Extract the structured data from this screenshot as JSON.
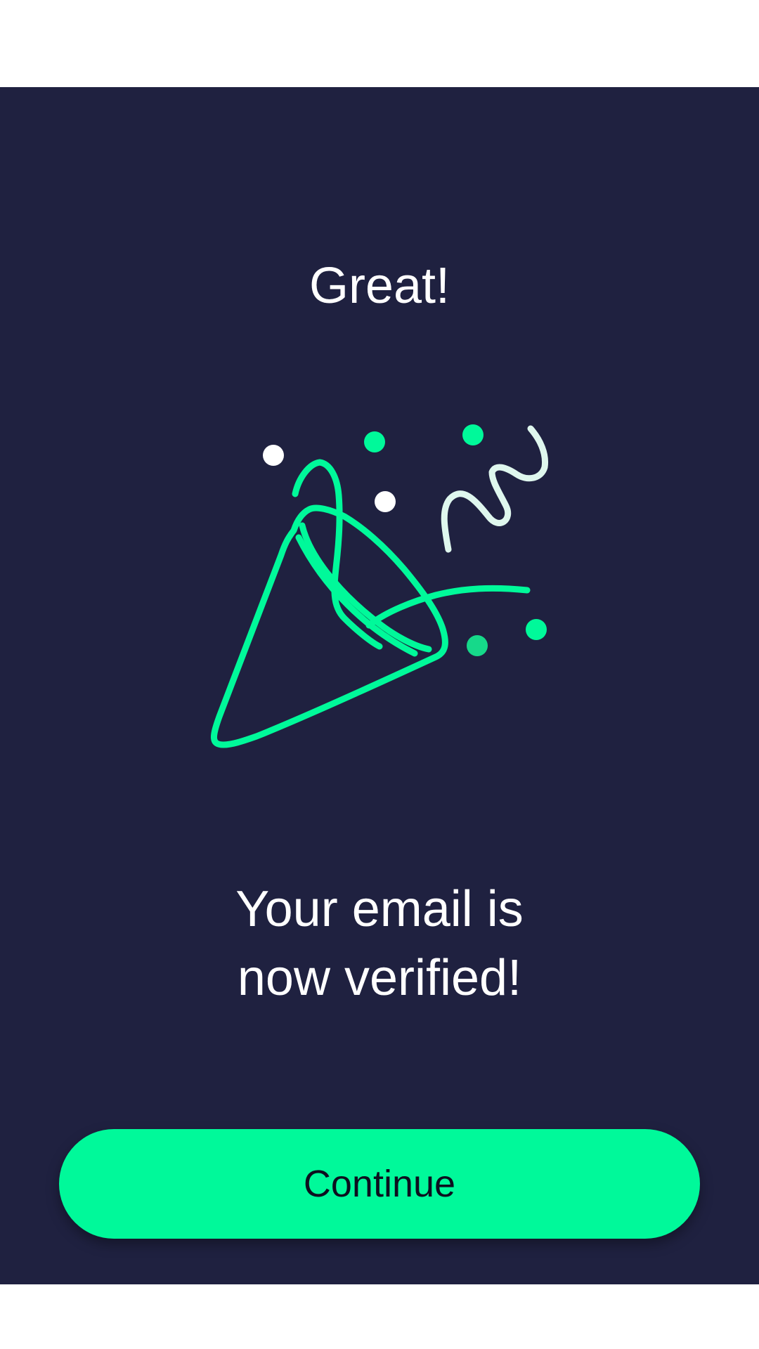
{
  "colors": {
    "background": "#1f2140",
    "accent": "#00f99a",
    "text": "#ffffff",
    "button_text": "#0d0f1f"
  },
  "heading": "Great!",
  "illustration": {
    "icon": "party-popper-icon"
  },
  "message": {
    "line1": "Your email is",
    "line2": "now verified!"
  },
  "continue_button": {
    "label": "Continue"
  }
}
